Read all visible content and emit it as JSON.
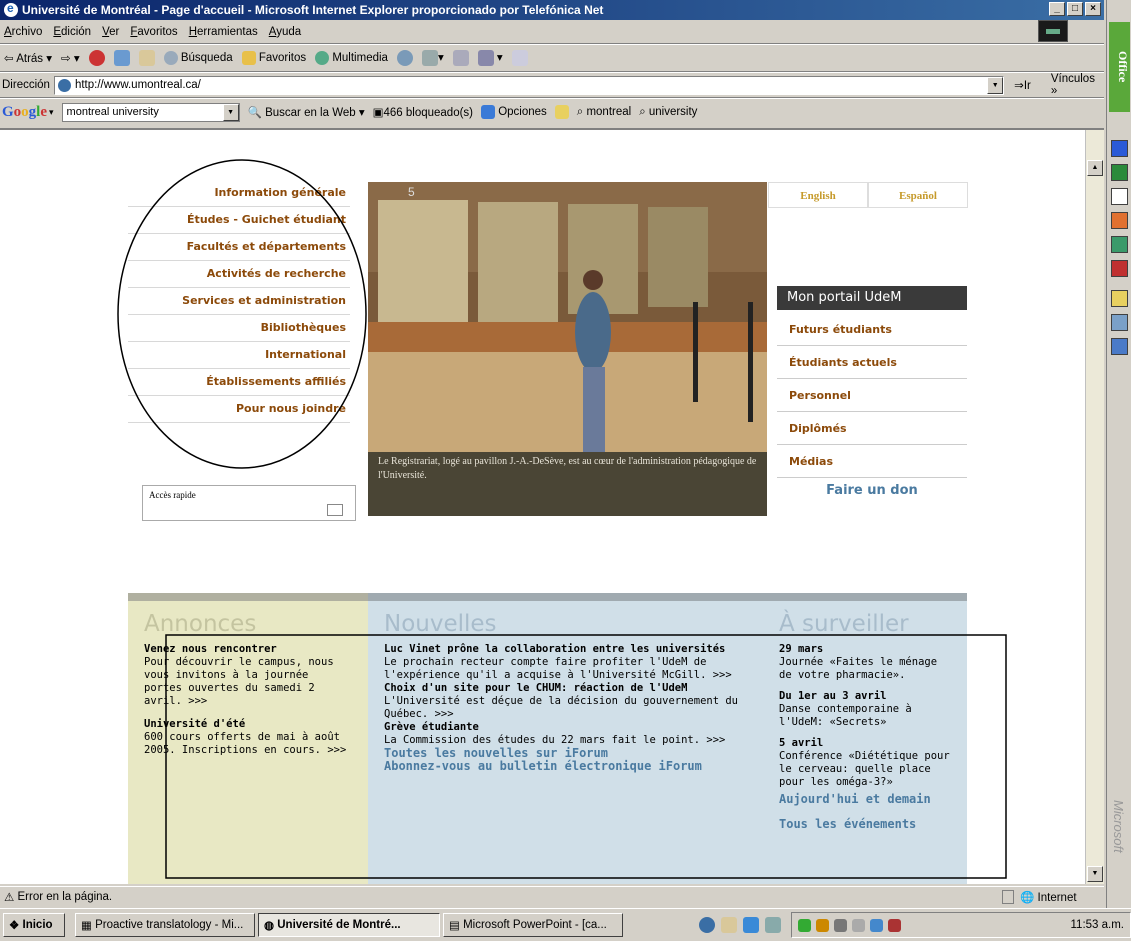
{
  "window": {
    "title": "Université de Montréal - Page d'accueil - Microsoft Internet Explorer proporcionado por Telefónica Net",
    "btn_min": "_",
    "btn_max": "□",
    "btn_close": "×"
  },
  "menu": [
    "Archivo",
    "Edición",
    "Ver",
    "Favoritos",
    "Herramientas",
    "Ayuda"
  ],
  "toolbar": {
    "back": "Atrás",
    "search": "Búsqueda",
    "favorites": "Favoritos",
    "multimedia": "Multimedia"
  },
  "address": {
    "label": "Dirección",
    "url": "http://www.umontreal.ca/",
    "go": "Ir",
    "links": "Vínculos"
  },
  "google": {
    "logo": "Google",
    "query": "montreal university",
    "search_btn": "Buscar en la Web",
    "blocked": "466 bloqueado(s)",
    "options": "Opciones",
    "term1": "montreal",
    "term2": "university"
  },
  "page": {
    "nav": [
      "Information générale",
      "Études - Guichet étudiant",
      "Facultés et départements",
      "Activités de recherche",
      "Services et administration",
      "Bibliothèques",
      "International",
      "Établissements affiliés",
      "Pour nous joindre"
    ],
    "quick_access": "Accès rapide",
    "caption": "Le Registrariat, logé au pavillon J.-A.-DeSève, est au cœur de l'administration pédagogique de l'Université.",
    "lang_en": "English",
    "lang_es": "Español",
    "portal": "Mon portail UdeM",
    "right_nav": [
      "Futurs étudiants",
      "Étudiants actuels",
      "Personnel",
      "Diplômés",
      "Médias"
    ],
    "donate": "Faire un don",
    "annonces": {
      "title": "Annonces",
      "items": [
        {
          "head": "Venez nous rencontrer",
          "text": "Pour découvrir le campus, nous vous invitons à la journée portes ouvertes du samedi 2 avril. >>>"
        },
        {
          "head": "Université d'été",
          "text": "600 cours offerts de mai à août 2005. Inscriptions en cours. >>>"
        }
      ]
    },
    "nouvelles": {
      "title": "Nouvelles",
      "items": [
        {
          "head": "Luc Vinet prône la collaboration entre les universités",
          "text": "Le prochain recteur compte faire profiter l'UdeM de l'expérience qu'il a acquise à l'Université McGill. >>>"
        },
        {
          "head": "Choix d'un site pour le CHUM: réaction de l'UdeM",
          "text": "L'Université est déçue de la décision du gouvernement du Québec. >>>"
        },
        {
          "head": "Grève étudiante",
          "text": "La Commission des études du 22 mars fait le point. >>>"
        }
      ],
      "link1": "Toutes les nouvelles sur iForum",
      "link2": "Abonnez-vous au bulletin électronique iForum"
    },
    "surveiller": {
      "title": "À surveiller",
      "items": [
        {
          "head": "29 mars",
          "text": "Journée «Faites le ménage de votre pharmacie»."
        },
        {
          "head": "Du 1er au 3 avril",
          "text": "Danse contemporaine à l'UdeM: «Secrets»"
        },
        {
          "head": "5 avril",
          "text": "Conférence «Diététique pour le cerveau: quelle place pour les oméga-3?»"
        }
      ],
      "link1": "Aujourd'hui et demain",
      "link2": "Tous les événements"
    }
  },
  "status": {
    "text": "Error en la página.",
    "zone": "Internet"
  },
  "taskbar": {
    "start": "Inicio",
    "tasks": [
      "Proactive translatology - Mi...",
      "Université de Montré...",
      "Microsoft PowerPoint - [ca..."
    ],
    "clock": "11:53 a.m."
  },
  "office": {
    "label": "Office",
    "brand": "Microsoft"
  }
}
